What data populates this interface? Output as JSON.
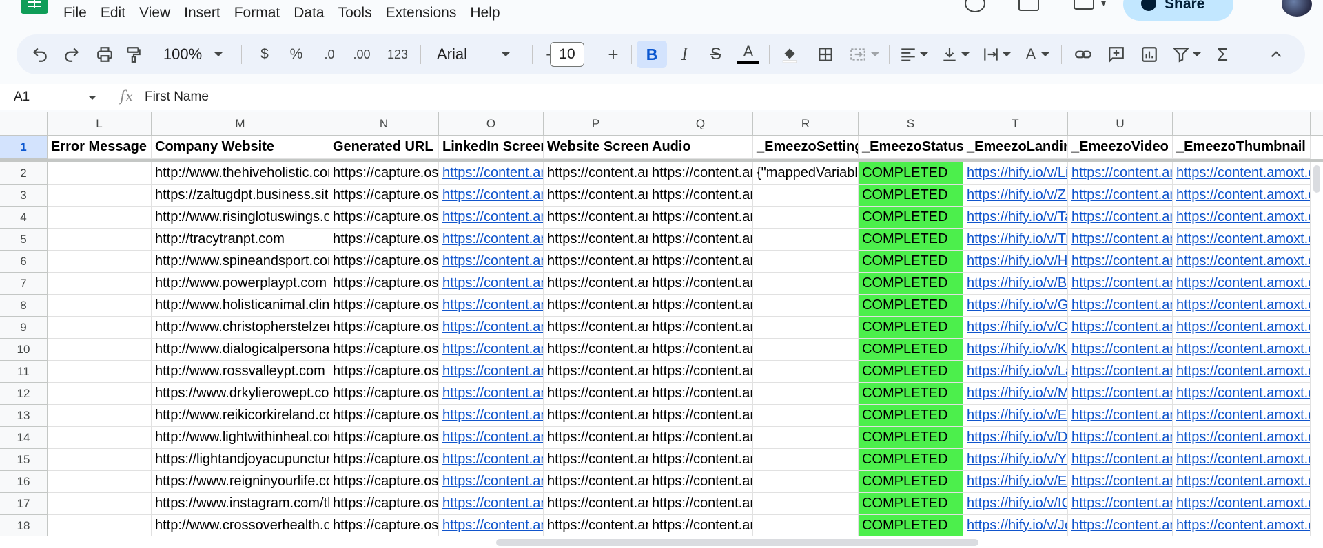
{
  "menu": [
    "File",
    "Edit",
    "View",
    "Insert",
    "Format",
    "Data",
    "Tools",
    "Extensions",
    "Help"
  ],
  "share_label": "Share",
  "toolbar": {
    "zoom": "100%",
    "currency": "$",
    "percent": "%",
    "dec_decrease": ".0",
    "dec_increase": ".00",
    "more_formats": "123",
    "font": "Arial",
    "minus": "–",
    "font_size": "10",
    "plus": "+",
    "bold": "B"
  },
  "formula": {
    "cell_ref": "A1",
    "fx": "fx",
    "content": "First Name"
  },
  "columns": [
    "L",
    "M",
    "N",
    "O",
    "P",
    "Q",
    "R",
    "S",
    "T",
    "U",
    ""
  ],
  "headers": [
    "Error Message",
    "Company Website",
    "Generated URL",
    "LinkedIn Screenshot",
    "Website Screenshot",
    "Audio",
    "_EmeezoSettings",
    "_EmeezoStatus",
    "_EmeezoLanding",
    "_EmeezoVideo",
    "_EmeezoThumbnail"
  ],
  "row_numbers": [
    "1",
    "2",
    "3",
    "4",
    "5",
    "6",
    "7",
    "8",
    "9",
    "10",
    "11",
    "12",
    "13",
    "14",
    "15",
    "16",
    "17",
    "18"
  ],
  "rows": [
    {
      "website": "http://www.thehiveholistic.com",
      "generated": "https://capture.os",
      "linkedin": "https://content.an",
      "website_shot": "https://content.an",
      "audio": "https://content.an",
      "settings": "{\"mappedVariables",
      "status": "COMPLETED",
      "landing": "https://hify.io/v/Li",
      "video": "https://content.an",
      "thumbnail": "https://content.amoxt.com"
    },
    {
      "website": "https://zaltugdpt.business.site",
      "generated": "https://capture.os",
      "linkedin": "https://content.an",
      "website_shot": "https://content.an",
      "audio": "https://content.an",
      "settings": "",
      "status": "COMPLETED",
      "landing": "https://hify.io/v/Zi",
      "video": "https://content.an",
      "thumbnail": "https://content.amoxt.com"
    },
    {
      "website": "http://www.risinglotuswings.com",
      "generated": "https://capture.os",
      "linkedin": "https://content.an",
      "website_shot": "https://content.an",
      "audio": "https://content.an",
      "settings": "",
      "status": "COMPLETED",
      "landing": "https://hify.io/v/Ta",
      "video": "https://content.an",
      "thumbnail": "https://content.amoxt.com"
    },
    {
      "website": "http://tracytranpt.com",
      "generated": "https://capture.os",
      "linkedin": "https://content.an",
      "website_shot": "https://content.an",
      "audio": "https://content.an",
      "settings": "",
      "status": "COMPLETED",
      "landing": "https://hify.io/v/Tr",
      "video": "https://content.an",
      "thumbnail": "https://content.amoxt.com"
    },
    {
      "website": "http://www.spineandsport.com",
      "generated": "https://capture.os",
      "linkedin": "https://content.an",
      "website_shot": "https://content.an",
      "audio": "https://content.an",
      "settings": "",
      "status": "COMPLETED",
      "landing": "https://hify.io/v/H",
      "video": "https://content.an",
      "thumbnail": "https://content.amoxt.com"
    },
    {
      "website": "http://www.powerplaypt.com",
      "generated": "https://capture.os",
      "linkedin": "https://content.an",
      "website_shot": "https://content.an",
      "audio": "https://content.an",
      "settings": "",
      "status": "COMPLETED",
      "landing": "https://hify.io/v/B",
      "video": "https://content.an",
      "thumbnail": "https://content.amoxt.com"
    },
    {
      "website": "http://www.holisticanimal.clinic",
      "generated": "https://capture.os",
      "linkedin": "https://content.an",
      "website_shot": "https://content.an",
      "audio": "https://content.an",
      "settings": "",
      "status": "COMPLETED",
      "landing": "https://hify.io/v/G",
      "video": "https://content.an",
      "thumbnail": "https://content.amoxt.com"
    },
    {
      "website": "http://www.christopherstelzer",
      "generated": "https://capture.os",
      "linkedin": "https://content.an",
      "website_shot": "https://content.an",
      "audio": "https://content.an",
      "settings": "",
      "status": "COMPLETED",
      "landing": "https://hify.io/v/C",
      "video": "https://content.an",
      "thumbnail": "https://content.amoxt.com"
    },
    {
      "website": "http://www.dialogicalpersonal",
      "generated": "https://capture.os",
      "linkedin": "https://content.an",
      "website_shot": "https://content.an",
      "audio": "https://content.an",
      "settings": "",
      "status": "COMPLETED",
      "landing": "https://hify.io/v/K",
      "video": "https://content.an",
      "thumbnail": "https://content.amoxt.com"
    },
    {
      "website": "http://www.rossvalleypt.com",
      "generated": "https://capture.os",
      "linkedin": "https://content.an",
      "website_shot": "https://content.an",
      "audio": "https://content.an",
      "settings": "",
      "status": "COMPLETED",
      "landing": "https://hify.io/v/La",
      "video": "https://content.an",
      "thumbnail": "https://content.amoxt.com"
    },
    {
      "website": "https://www.drkylierowept.com",
      "generated": "https://capture.os",
      "linkedin": "https://content.an",
      "website_shot": "https://content.an",
      "audio": "https://content.an",
      "settings": "",
      "status": "COMPLETED",
      "landing": "https://hify.io/v/M",
      "video": "https://content.an",
      "thumbnail": "https://content.amoxt.com"
    },
    {
      "website": "http://www.reikicorkireland.com",
      "generated": "https://capture.os",
      "linkedin": "https://content.an",
      "website_shot": "https://content.an",
      "audio": "https://content.an",
      "settings": "",
      "status": "COMPLETED",
      "landing": "https://hify.io/v/E",
      "video": "https://content.an",
      "thumbnail": "https://content.amoxt.com"
    },
    {
      "website": "http://www.lightwithinheal.com",
      "generated": "https://capture.os",
      "linkedin": "https://content.an",
      "website_shot": "https://content.an",
      "audio": "https://content.an",
      "settings": "",
      "status": "COMPLETED",
      "landing": "https://hify.io/v/D",
      "video": "https://content.an",
      "thumbnail": "https://content.amoxt.com"
    },
    {
      "website": "https://lightandjoyacupuncture",
      "generated": "https://capture.os",
      "linkedin": "https://content.an",
      "website_shot": "https://content.an",
      "audio": "https://content.an",
      "settings": "",
      "status": "COMPLETED",
      "landing": "https://hify.io/v/Y",
      "video": "https://content.an",
      "thumbnail": "https://content.amoxt.com"
    },
    {
      "website": "https://www.reigninyourlife.com",
      "generated": "https://capture.os",
      "linkedin": "https://content.an",
      "website_shot": "https://content.an",
      "audio": "https://content.an",
      "settings": "",
      "status": "COMPLETED",
      "landing": "https://hify.io/v/E",
      "video": "https://content.an",
      "thumbnail": "https://content.amoxt.com"
    },
    {
      "website": "https://www.instagram.com/th",
      "generated": "https://capture.os",
      "linkedin": "https://content.an",
      "website_shot": "https://content.an",
      "audio": "https://content.an",
      "settings": "",
      "status": "COMPLETED",
      "landing": "https://hify.io/v/IC",
      "video": "https://content.an",
      "thumbnail": "https://content.amoxt.com"
    },
    {
      "website": "http://www.crossoverhealth.com",
      "generated": "https://capture.os",
      "linkedin": "https://content.an",
      "website_shot": "https://content.an",
      "audio": "https://content.an",
      "settings": "",
      "status": "COMPLETED",
      "landing": "https://hify.io/v/Jc",
      "video": "https://content.an",
      "thumbnail": "https://content.amoxt.com"
    }
  ],
  "colors": {
    "status_green": "#4cef4c",
    "link_blue": "#1155cc",
    "toolbar_bg": "#edf2fa",
    "share_bg": "#c2e7ff"
  }
}
